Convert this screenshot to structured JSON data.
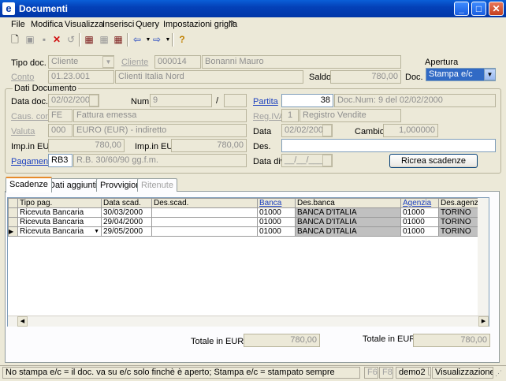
{
  "window": {
    "title": "Documenti",
    "app_icon": "e"
  },
  "menu": [
    "File",
    "Modifica",
    "Visualizza",
    "Inserisci",
    "Query",
    "Impostazioni griglia",
    "?"
  ],
  "header": {
    "tipo_doc_label": "Tipo doc.",
    "tipo_doc_value": "Cliente",
    "cliente_label": "Cliente",
    "cliente_code": "000014",
    "cliente_name": "Bonanni Mauro",
    "conto_label": "Conto",
    "conto_code": "01.23.001",
    "conto_name": "Clienti Italia Nord",
    "saldo_label": "Saldo",
    "saldo_value": "780,00",
    "apertura_label": "Apertura",
    "doc_label": "Doc.",
    "doc_value": "Stampa e/c"
  },
  "dati": {
    "group_label": "Dati Documento",
    "data_doc_label": "Data doc.",
    "data_doc_value": "02/02/2000",
    "num_label": "Num.",
    "num_value": "9",
    "num_sep": "/",
    "num_suffix": "",
    "partita_label": "Partita",
    "partita_value": "38",
    "partita_desc": "Doc.Num: 9 del 02/02/2000",
    "caus_label": "Caus. cont.",
    "caus_code": "FE",
    "caus_desc": "Fattura emessa",
    "regiva_label": "Reg.IVA",
    "regiva_code": "1",
    "regiva_desc": "Registro Vendite",
    "valuta_label": "Valuta",
    "valuta_code": "000",
    "valuta_desc": "EURO (EUR) - indiretto",
    "data_label": "Data",
    "data_value": "02/02/2000",
    "cambio_label": "Cambio",
    "cambio_value": "1,000000",
    "imp_label1": "Imp.in EUR",
    "imp_value1": "780,00",
    "imp_label2": "Imp.in EUR",
    "imp_value2": "780,00",
    "des_label": "Des.",
    "des_value": "",
    "pagamento_label": "Pagamento",
    "pagamento_code": "RB3",
    "pagamento_desc": "R.B. 30/60/90 gg.f.m.",
    "data_div_label": "Data div.",
    "data_div_value": "__/__/____",
    "ricrea_button": "Ricrea scadenze"
  },
  "tabs": [
    "Scadenze",
    "Dati aggiuntivi",
    "Provvigioni",
    "Ritenute"
  ],
  "grid": {
    "columns": [
      "Tipo pag.",
      "Data scad.",
      "Des.scad.",
      "Banca",
      "Des.banca",
      "Agenzia",
      "Des.agenzia"
    ],
    "rows": [
      [
        "Ricevuta Bancaria",
        "30/03/2000",
        "",
        "01000",
        "BANCA D'ITALIA",
        "01000",
        "TORINO"
      ],
      [
        "Ricevuta Bancaria",
        "29/04/2000",
        "",
        "01000",
        "BANCA D'ITALIA",
        "01000",
        "TORINO"
      ],
      [
        "Ricevuta Bancaria",
        "29/05/2000",
        "",
        "01000",
        "BANCA D'ITALIA",
        "01000",
        "TORINO"
      ]
    ]
  },
  "totals": {
    "label1": "Totale in EUR",
    "value1": "780,00",
    "label2": "Totale in EUR",
    "value2": "780,00"
  },
  "status": {
    "message": "No stampa e/c = il doc. va su e/c solo finchè è aperto; Stampa e/c = stampato sempre",
    "f6": "F6",
    "f8": "F8",
    "db": "demo2",
    "mode": "Visualizzazione"
  }
}
